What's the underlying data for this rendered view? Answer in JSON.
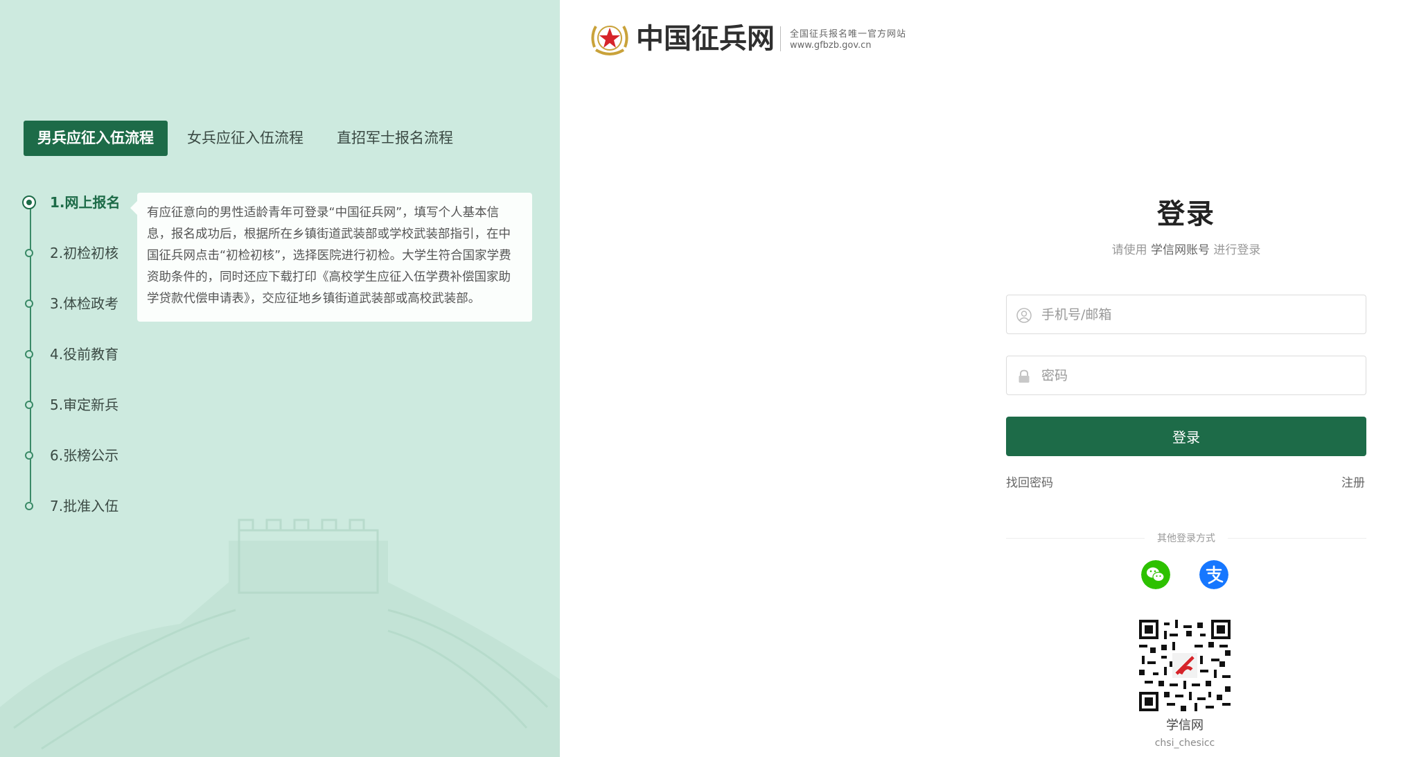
{
  "flow_tabs": [
    {
      "label": "男兵应征入伍流程",
      "active": true
    },
    {
      "label": "女兵应征入伍流程",
      "active": false
    },
    {
      "label": "直招军士报名流程",
      "active": false
    }
  ],
  "steps": [
    {
      "label": "1.网上报名",
      "active": true
    },
    {
      "label": "2.初检初核",
      "active": false
    },
    {
      "label": "3.体检政考",
      "active": false
    },
    {
      "label": "4.役前教育",
      "active": false
    },
    {
      "label": "5.审定新兵",
      "active": false
    },
    {
      "label": "6.张榜公示",
      "active": false
    },
    {
      "label": "7.批准入伍",
      "active": false
    }
  ],
  "step_description": "有应征意向的男性适龄青年可登录“中国征兵网”，填写个人基本信息，报名成功后，根据所在乡镇街道武装部或学校武装部指引，在中国征兵网点击“初检初核”，选择医院进行初检。大学生符合国家学费资助条件的，同时还应下载打印《高校学生应征入伍学费补偿国家助学贷款代偿申请表》，交应征地乡镇街道武装部或高校武装部。",
  "brand": {
    "title": "中国征兵网",
    "subtitle": "全国征兵报名唯一官方网站",
    "url": "www.gfbzb.gov.cn"
  },
  "login": {
    "title": "登录",
    "subtitle_prefix": "请使用",
    "subtitle_highlight": "学信网账号",
    "subtitle_suffix": "进行登录",
    "username_placeholder": "手机号/邮箱",
    "password_placeholder": "密码",
    "submit_label": "登录",
    "forgot_label": "找回密码",
    "register_label": "注册",
    "other_methods_label": "其他登录方式"
  },
  "qr": {
    "label": "学信网",
    "sub": "chsi_chesicc"
  },
  "colors": {
    "primary": "#1d6b48",
    "left_bg": "#cdeadf",
    "wechat": "#2dc100",
    "alipay": "#1677ff"
  }
}
